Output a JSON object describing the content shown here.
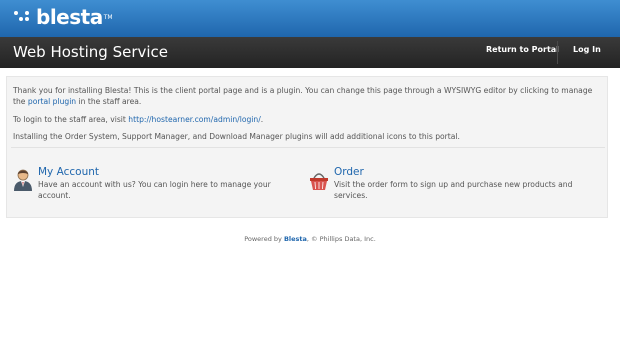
{
  "header": {
    "logo_text": "blesta",
    "logo_tm": "TM"
  },
  "titlebar": {
    "title": "Web Hosting Service",
    "nav": [
      {
        "label": "Return to Portal"
      },
      {
        "label": "Log In"
      }
    ]
  },
  "content": {
    "intro": {
      "part1": "Thank you for installing Blesta! This is the client portal page and is a plugin. You can change this page through a WYSIWYG editor by clicking to manage the ",
      "link": "portal plugin",
      "part2": " in the staff area."
    },
    "login_line": {
      "text": "To login to the staff area, visit ",
      "link": "http://hostearner.com/admin/login/",
      "end": "."
    },
    "plugins_line": "Installing the Order System, Support Manager, and Download Manager plugins will add additional icons to this portal.",
    "items": [
      {
        "icon": "user-icon",
        "title": "My Account",
        "description": "Have an account with us? You can login here to manage your account."
      },
      {
        "icon": "basket-icon",
        "title": "Order",
        "description": "Visit the order form to sign up and purchase new products and services."
      }
    ]
  },
  "footer": {
    "prefix": "Powered by ",
    "brand": "Blesta",
    "suffix": ", © Phillips Data, Inc."
  },
  "colors": {
    "top_bar": "#2d7bc4",
    "title_bar": "#2b2b2b",
    "link": "#1f66ad"
  }
}
